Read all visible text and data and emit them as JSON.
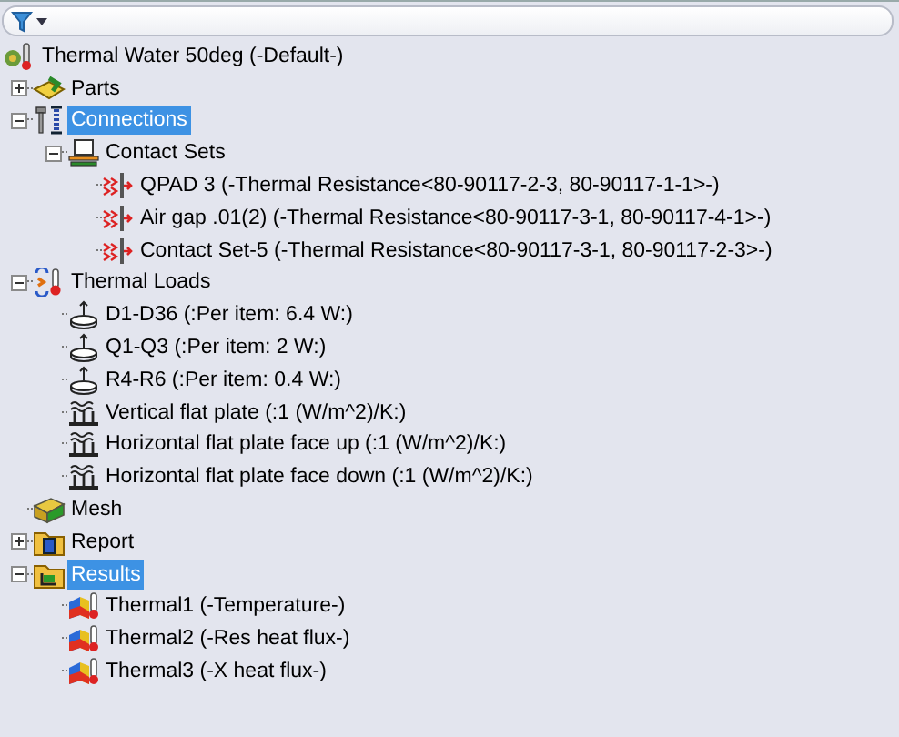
{
  "tree": {
    "label": "Thermal Water 50deg (-Default-)",
    "kind": "study",
    "selected": false,
    "children": [
      {
        "label": "Parts",
        "kind": "parts",
        "expanded": false,
        "selected": false
      },
      {
        "label": "Connections",
        "kind": "connections",
        "expanded": true,
        "selected": true,
        "children": [
          {
            "label": "Contact Sets",
            "kind": "contact-sets",
            "expanded": true,
            "selected": false,
            "children": [
              {
                "label": "QPAD 3 (-Thermal Resistance<80-90117-2-3, 80-90117-1-1>-)",
                "kind": "contact",
                "selected": false
              },
              {
                "label": "Air gap .01(2) (-Thermal Resistance<80-90117-3-1, 80-90117-4-1>-)",
                "kind": "contact",
                "selected": false
              },
              {
                "label": "Contact Set-5 (-Thermal Resistance<80-90117-3-1, 80-90117-2-3>-)",
                "kind": "contact",
                "selected": false
              }
            ]
          }
        ]
      },
      {
        "label": "Thermal Loads",
        "kind": "thermal-loads",
        "expanded": true,
        "selected": false,
        "children": [
          {
            "label": "D1-D36 (:Per item: 6.4 W:)",
            "kind": "heat-power",
            "selected": false
          },
          {
            "label": "Q1-Q3 (:Per item: 2 W:)",
            "kind": "heat-power",
            "selected": false
          },
          {
            "label": "R4-R6 (:Per item: 0.4 W:)",
            "kind": "heat-power",
            "selected": false
          },
          {
            "label": "Vertical flat plate (:1 (W/m^2)/K:)",
            "kind": "convection",
            "selected": false
          },
          {
            "label": "Horizontal flat plate face up (:1 (W/m^2)/K:)",
            "kind": "convection",
            "selected": false
          },
          {
            "label": "Horizontal flat plate face down (:1 (W/m^2)/K:)",
            "kind": "convection",
            "selected": false
          }
        ]
      },
      {
        "label": "Mesh",
        "kind": "mesh",
        "selected": false
      },
      {
        "label": "Report",
        "kind": "report",
        "expanded": false,
        "selected": false
      },
      {
        "label": "Results",
        "kind": "results",
        "expanded": true,
        "selected": true,
        "children": [
          {
            "label": "Thermal1 (-Temperature-)",
            "kind": "plot",
            "selected": false
          },
          {
            "label": "Thermal2 (-Res heat flux-)",
            "kind": "plot",
            "selected": false
          },
          {
            "label": "Thermal3 (-X heat flux-)",
            "kind": "plot",
            "selected": false
          }
        ]
      }
    ]
  }
}
